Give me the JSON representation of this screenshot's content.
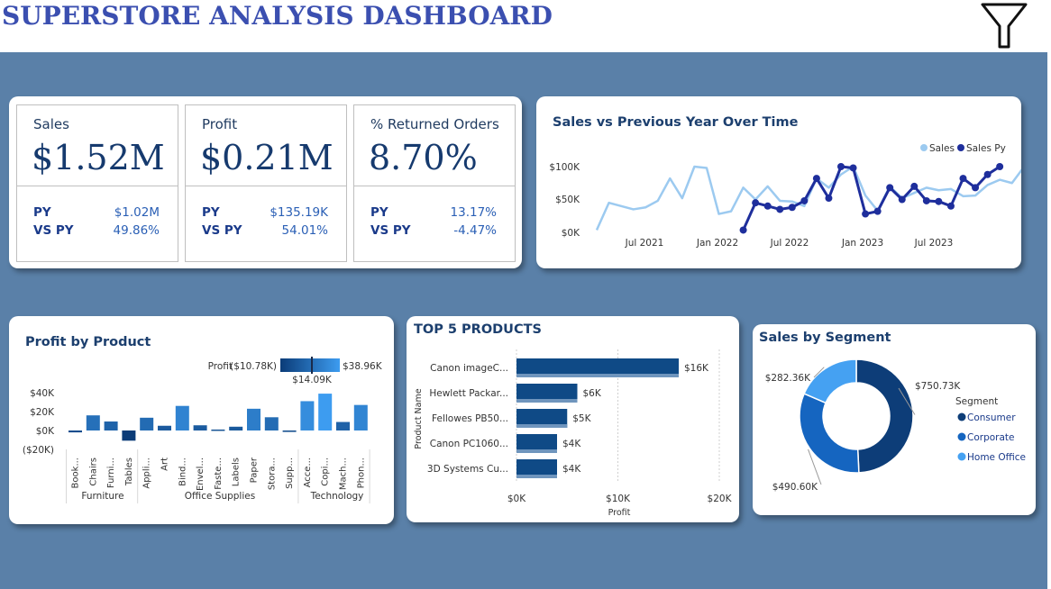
{
  "header": {
    "title": "SUPERSTORE ANALYSIS DASHBOARD"
  },
  "kpis": [
    {
      "label": "Sales",
      "value": "$1.52M",
      "py_label": "PY",
      "py": "$1.02M",
      "vspy_label": "VS PY",
      "vspy": "49.86%"
    },
    {
      "label": "Profit",
      "value": "$0.21M",
      "py_label": "PY",
      "py": "$135.19K",
      "vspy_label": "VS PY",
      "vspy": "54.01%"
    },
    {
      "label": "% Returned Orders",
      "value": "8.70%",
      "py_label": "PY",
      "py": "13.17%",
      "vspy_label": "VS PY",
      "vspy": "-4.47%"
    }
  ],
  "line_chart": {
    "title": "Sales vs Previous Year Over Time",
    "legend": [
      "Sales",
      "Sales Py"
    ],
    "y_ticks": [
      "$100K",
      "$50K",
      "$0K"
    ],
    "x_ticks": [
      "Jul 2021",
      "Jan 2022",
      "Jul 2022",
      "Jan 2023",
      "Jul 2023"
    ]
  },
  "profit_product": {
    "title": "Profit by Product",
    "legend_label": "Profit",
    "legend_min": "($10.78K)",
    "legend_max": "$38.96K",
    "legend_mid": "$14.09K",
    "y_ticks": [
      "$40K",
      "$20K",
      "$0K",
      "($20K)"
    ],
    "groups": [
      "Furniture",
      "Office Supplies",
      "Technology"
    ]
  },
  "top5": {
    "title": "TOP 5 PRODUCTS",
    "y_label": "Product Name",
    "x_label": "Profit",
    "x_ticks": [
      "$0K",
      "$10K",
      "$20K"
    ]
  },
  "segment": {
    "title": "Sales by Segment",
    "legend_title": "Segment",
    "legend": [
      "Consumer",
      "Corporate",
      "Home Office"
    ]
  },
  "chart_data": [
    {
      "type": "line",
      "title": "Sales vs Previous Year Over Time",
      "ylim": [
        0,
        110000
      ],
      "x_start": "2021-01",
      "series": [
        {
          "name": "Sales",
          "color": "#9ccaf0",
          "values": [
            3500,
            45000,
            40000,
            35000,
            38000,
            48000,
            82000,
            52000,
            100000,
            98000,
            28000,
            32000,
            68000,
            50000,
            70000,
            48000,
            47000,
            40000,
            82000,
            68000,
            88000,
            100000,
            56000,
            33000,
            70000,
            52000,
            60000,
            68000,
            64000,
            66000,
            55000,
            56000,
            72000,
            80000,
            75000,
            100000
          ]
        },
        {
          "name": "Sales Py",
          "color": "#1e2e9c",
          "values": [
            null,
            null,
            null,
            null,
            null,
            null,
            null,
            null,
            null,
            null,
            null,
            null,
            3500,
            45000,
            40000,
            35000,
            38000,
            48000,
            82000,
            52000,
            100000,
            98000,
            28000,
            32000,
            68000,
            50000,
            70000,
            48000,
            47000,
            40000,
            82000,
            68000,
            88000,
            100000
          ]
        }
      ]
    },
    {
      "type": "bar",
      "title": "Profit by Product",
      "categories": [
        "Book...",
        "Chairs",
        "Furni...",
        "Tables",
        "Appli...",
        "Art",
        "Bind...",
        "Envel...",
        "Faste...",
        "Labels",
        "Paper",
        "Stora...",
        "Supp...",
        "Acce...",
        "Copi...",
        "Mach...",
        "Phon..."
      ],
      "values": [
        -2000,
        16000,
        9500,
        -10780,
        13500,
        5000,
        26000,
        5500,
        1000,
        4000,
        23000,
        14000,
        -1500,
        31000,
        38960,
        9000,
        27000
      ],
      "groups": [
        {
          "name": "Furniture",
          "count": 4
        },
        {
          "name": "Office Supplies",
          "count": 9
        },
        {
          "name": "Technology",
          "count": 4
        }
      ],
      "ylim": [
        -20000,
        40000
      ]
    },
    {
      "type": "bar",
      "title": "TOP 5 PRODUCTS",
      "xlabel": "Profit",
      "ylabel": "Product Name",
      "categories": [
        "Canon imageC...",
        "Hewlett Packar...",
        "Fellowes PB50...",
        "Canon PC1060...",
        "3D Systems Cu..."
      ],
      "values": [
        16000,
        6000,
        5000,
        4000,
        4000
      ],
      "labels": [
        "$16K",
        "$6K",
        "$5K",
        "$4K",
        "$4K"
      ],
      "xlim": [
        0,
        20000
      ]
    },
    {
      "type": "pie",
      "title": "Sales by Segment",
      "categories": [
        "Consumer",
        "Corporate",
        "Home Office"
      ],
      "values": [
        750730,
        490600,
        282360
      ],
      "labels": [
        "$750.73K",
        "$490.60K",
        "$282.36K"
      ],
      "colors": [
        "#0d3d78",
        "#1565c0",
        "#45a1f2"
      ]
    }
  ]
}
